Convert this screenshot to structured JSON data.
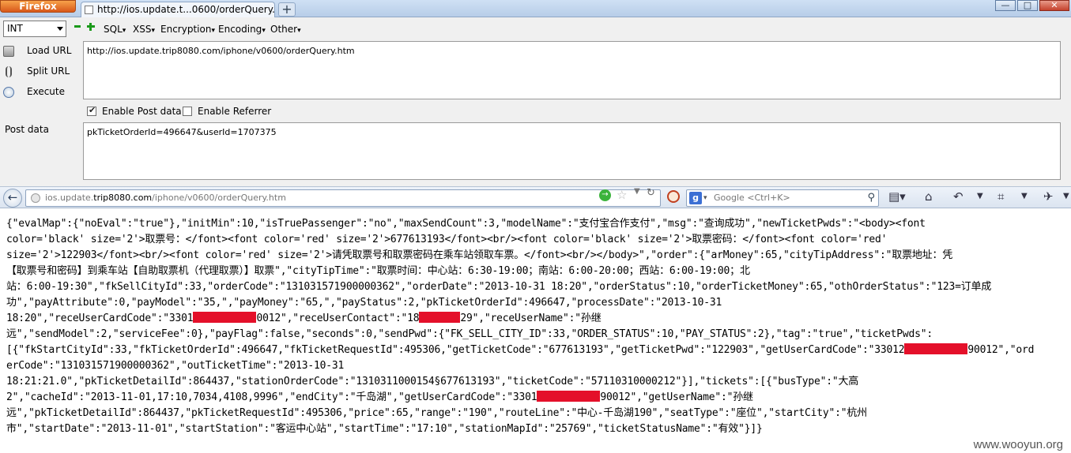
{
  "browser": {
    "app_button": "Firefox",
    "tab_title": "http://ios.update.t...0600/orderQuery.htm",
    "new_tab": "+",
    "controls": {
      "minimize": "—",
      "maximize": "□",
      "close": "✕"
    }
  },
  "hackbar": {
    "encoding_select": "INT",
    "menus": [
      "SQL",
      "XSS",
      "Encryption",
      "Encoding",
      "Other"
    ],
    "actions": {
      "load": "Load URL",
      "split": "Split URL",
      "execute": "Execute"
    },
    "url_value": "http://ios.update.trip8080.com/iphone/v0600/orderQuery.htm",
    "enable_post": "Enable Post data",
    "enable_post_checked": true,
    "enable_referrer": "Enable Referrer",
    "enable_referrer_checked": false,
    "post_label": "Post data",
    "post_value": "pkTicketOrderId=496647&userId=1707375"
  },
  "navbar": {
    "back": "←",
    "url_prefix": "ios.update.",
    "url_host": "trip8080.com",
    "url_path": "/iphone/v0600/orderQuery.htm",
    "go": "→",
    "search_engine": "g",
    "search_placeholder": "Google <Ctrl+K>"
  },
  "content": {
    "lines": [
      "{\"evalMap\":{\"noEval\":\"true\"},\"initMin\":10,\"isTruePassenger\":\"no\",\"maxSendCount\":3,\"modelName\":\"支付宝合作支付\",\"msg\":\"查询成功\",\"newTicketPwds\":\"<body><font",
      "color='black' size='2'>取票号：</font><font color='red' size='2'>677613193</font><br/><font color='black' size='2'>取票密码：</font><font color='red'",
      "size='2'>122903</font><br/><font color='red' size='2'>请凭取票号和取票密码在乘车站领取车票。</font><br/></body>\",\"order\":{\"arMoney\":65,\"cityTipAddress\":\"取票地址：凭",
      "【取票号和密码】到乘车站【自助取票机（代理取票）】取票\",\"cityTipTime\":\"取票时间：中心站：6:30-19:00；南站：6:00-20:00；西站：6:00-19:00；北",
      "站：6:00-19:30\",\"fkSellCityId\":33,\"orderCode\":\"131031571900000362\",\"orderDate\":\"2013-10-31 18:20\",\"orderStatus\":10,\"orderTicketMoney\":65,\"othOrderStatus\":\"123=订单成",
      "功\",\"payAttribute\":0,\"payModel\":\"35,\",\"payMoney\":\"65,\",\"payStatus\":2,\"pkTicketOrderId\":496647,\"processDate\":\"2013-10-31",
      [
        "18:20\",\"receUserCardCode\":\"3301",
        "0012\",\"receUserContact\":\"18",
        "29\",\"receUserName\":\"孙继"
      ],
      "远\",\"sendModel\":2,\"serviceFee\":0},\"payFlag\":false,\"seconds\":0,\"sendPwd\":{\"FK_SELL_CITY_ID\":33,\"ORDER_STATUS\":10,\"PAY_STATUS\":2},\"tag\":\"true\",\"ticketPwds\":",
      [
        "[{\"fkStartCityId\":33,\"fkTicketOrderId\":496647,\"fkTicketRequestId\":495306,\"getTicketCode\":\"677613193\",\"getTicketPwd\":\"122903\",\"getUserCardCode\":\"33012",
        "90012\",\"ord"
      ],
      "erCode\":\"131031571900000362\",\"outTicketTime\":\"2013-10-31",
      "18:21:21.0\",\"pkTicketDetailId\":864437,\"stationOrderCode\":\"1310311000154§677613193\",\"ticketCode\":\"57110310000212\"}],\"tickets\":[{\"busType\":\"大高",
      [
        "2\",\"cacheId\":\"2013-11-01,17:10,7034,4108,9996\",\"endCity\":\"千岛湖\",\"getUserCardCode\":\"3301",
        "90012\",\"getUserName\":\"孙继"
      ],
      "远\",\"pkTicketDetailId\":864437,\"pkTicketRequestId\":495306,\"price\":65,\"range\":\"190\",\"routeLine\":\"中心-千岛湖190\",\"seatType\":\"座位\",\"startCity\":\"杭州",
      "市\",\"startDate\":\"2013-11-01\",\"startStation\":\"客运中心站\",\"startTime\":\"17:10\",\"stationMapId\":\"25769\",\"ticketStatusName\":\"有效\"}]}"
    ]
  },
  "watermark": "www.wooyun.org",
  "colors": {
    "redaction": "#e4102a",
    "firefox_orange": "#e66a25"
  }
}
